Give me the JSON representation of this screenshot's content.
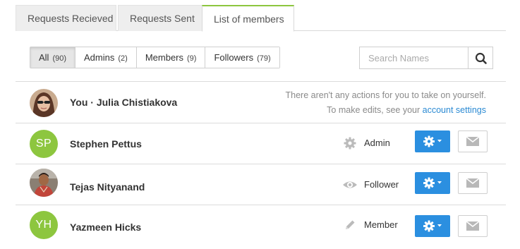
{
  "tabs": [
    {
      "label": "Requests Recieved"
    },
    {
      "label": "Requests Sent"
    },
    {
      "label": "List of members"
    }
  ],
  "filters": [
    {
      "label": "All",
      "count": "(90)"
    },
    {
      "label": "Admins",
      "count": "(2)"
    },
    {
      "label": "Members",
      "count": "(9)"
    },
    {
      "label": "Followers",
      "count": "(79)"
    }
  ],
  "search": {
    "placeholder": "Search Names"
  },
  "self_row": {
    "name": "You · Julia Chistiakova",
    "note_line1": "There aren't any actions for you to take on yourself.",
    "note_line2": "To make edits, see your",
    "note_link": "account settings"
  },
  "members": [
    {
      "initials": "SP",
      "name": "Stephen Pettus",
      "role": "Admin",
      "role_icon": "gear-icon"
    },
    {
      "initials": "",
      "name": "Tejas Nityanand",
      "role": "Follower",
      "role_icon": "eye-icon"
    },
    {
      "initials": "YH",
      "name": "Yazmeen Hicks",
      "role": "Member",
      "role_icon": "pencil-icon"
    }
  ],
  "colors": {
    "accent_green": "#8dc63f",
    "button_blue": "#2b8fe0",
    "link_blue": "#2b8ad3"
  }
}
